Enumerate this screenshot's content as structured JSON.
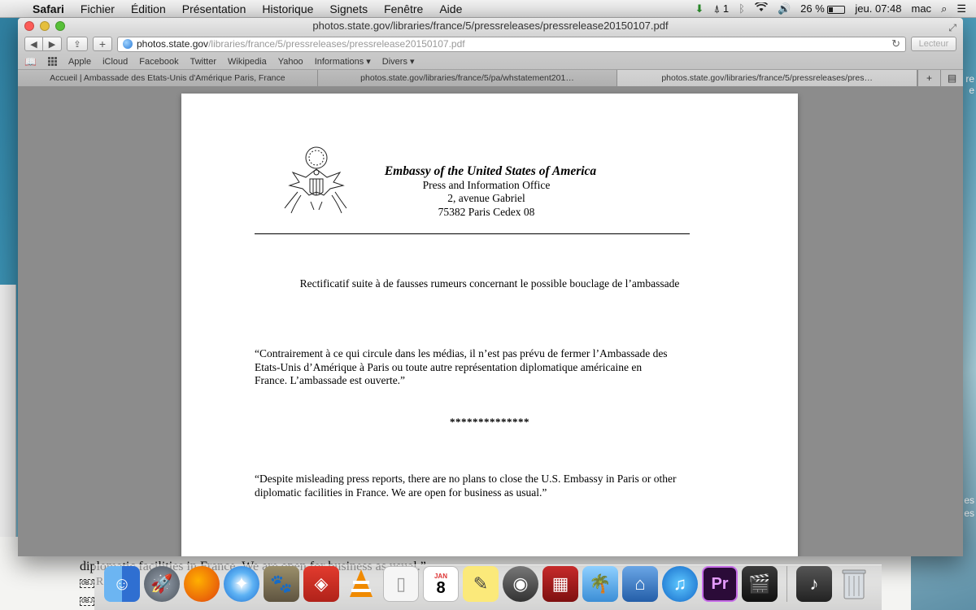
{
  "menubar": {
    "app_name": "Safari",
    "items": [
      "Fichier",
      "Édition",
      "Présentation",
      "Historique",
      "Signets",
      "Fenêtre",
      "Aide"
    ],
    "status": {
      "adobe": "1",
      "battery_pct": "26 %",
      "clock": "jeu. 07:48",
      "user": "mac"
    }
  },
  "window": {
    "title": "photos.state.gov/libraries/france/5/pressreleases/pressrelease20150107.pdf",
    "url_host": "photos.state.gov",
    "url_path": "/libraries/france/5/pressreleases/pressrelease20150107.pdf",
    "reader_label": "Lecteur",
    "new_tab_label": "+"
  },
  "bookmarks": [
    "Apple",
    "iCloud",
    "Facebook",
    "Twitter",
    "Wikipedia",
    "Yahoo",
    "Informations ▾",
    "Divers ▾"
  ],
  "tabs": [
    {
      "label": "Accueil | Ambassade des Etats-Unis d'Amérique Paris, France"
    },
    {
      "label": "photos.state.gov/libraries/france/5/pa/whstatement201…"
    },
    {
      "label": "photos.state.gov/libraries/france/5/pressreleases/pres…"
    }
  ],
  "document": {
    "header_title": "Embassy of the United States of America",
    "office": "Press and Information Office",
    "address1": "2, avenue Gabriel",
    "address2": "75382 Paris Cedex 08",
    "subject": "Rectificatif suite à de fausses rumeurs concernant le possible bouclage de l’ambassade",
    "french_line1": "“Contrairement à ce qui circule dans les médias, il n’est pas prévu de fermer l’Ambassade des",
    "french_line2": "Etats-Unis d’Amérique à Paris ou toute autre représentation diplomatique américaine en",
    "french_line3": "France.  L’ambassade est ouverte.”",
    "separator": "**************",
    "english_line1": "“Despite misleading press reports, there are no plans to close the U.S. Embassy in Paris or other",
    "english_line2": "diplomatic facilities in France. We are open for business as usual.”"
  },
  "desktop": {
    "doc_text": "diplomatic facilities in France. We are open for business as usual.”",
    "obj1": "OBJ",
    "obj1_suffix": "R",
    "obj2": "OBJ",
    "right_fragment_top": "re",
    "right_fragment_top2": "e",
    "right_fragment_bottom": "es",
    "right_fragment_bottom2": "es"
  },
  "dock": {
    "calendar_month": "JAN",
    "calendar_day": "8"
  },
  "colors": {
    "tl_close": "#fc5b57",
    "tl_min": "#e5bf3c",
    "tl_max": "#57c038"
  }
}
